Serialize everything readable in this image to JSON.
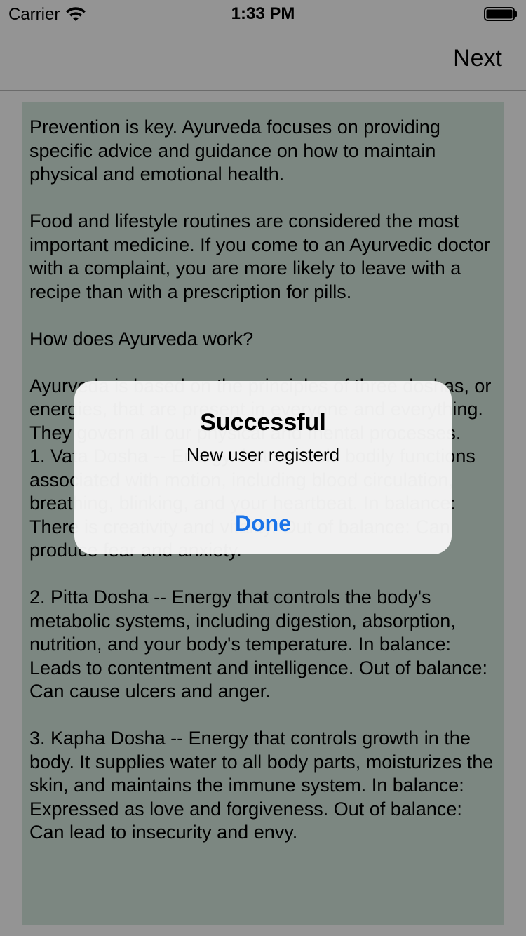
{
  "status_bar": {
    "carrier": "Carrier",
    "time": "1:33 PM",
    "wifi_icon": "wifi-icon",
    "battery_icon": "battery-icon"
  },
  "nav_bar": {
    "next_label": "Next"
  },
  "content": {
    "text": "Prevention is key. Ayurveda focuses on providing specific advice and guidance on how to maintain physical and emotional health.\n\nFood and lifestyle routines are considered the most important medicine. If you come to an Ayurvedic doctor with a complaint, you are more likely to leave with a recipe than with a prescription for pills.\n\nHow does Ayurveda work?\n\nAyurveda is based on the principles of three doshas, or energies, that are present in everyone and everything. They govern all our physical and mental processes.\n1. Vata Dosha -- Energy that controls bodily functions associated with motion, including blood circulation, breathing, blinking, and your heartbeat. In balance: There is creativity and vitality. Out of balance: Can produce fear and anxiety.\n\n2. Pitta Dosha -- Energy that controls the body's metabolic systems, including digestion, absorption, nutrition, and your body's temperature. In balance: Leads to contentment and intelligence. Out of balance: Can cause ulcers and anger.\n\n3. Kapha Dosha -- Energy that controls growth in the body. It supplies water to all body parts, moisturizes the skin, and maintains the immune system. In balance: Expressed as love and forgiveness. Out of balance: Can lead to insecurity and envy."
  },
  "alert": {
    "title": "Successful",
    "message": "New user registerd",
    "button_label": "Done"
  },
  "colors": {
    "accent": "#1a73e8",
    "content_background": "#cfe2d8",
    "overlay": "rgba(0,0,0,0.4)"
  }
}
